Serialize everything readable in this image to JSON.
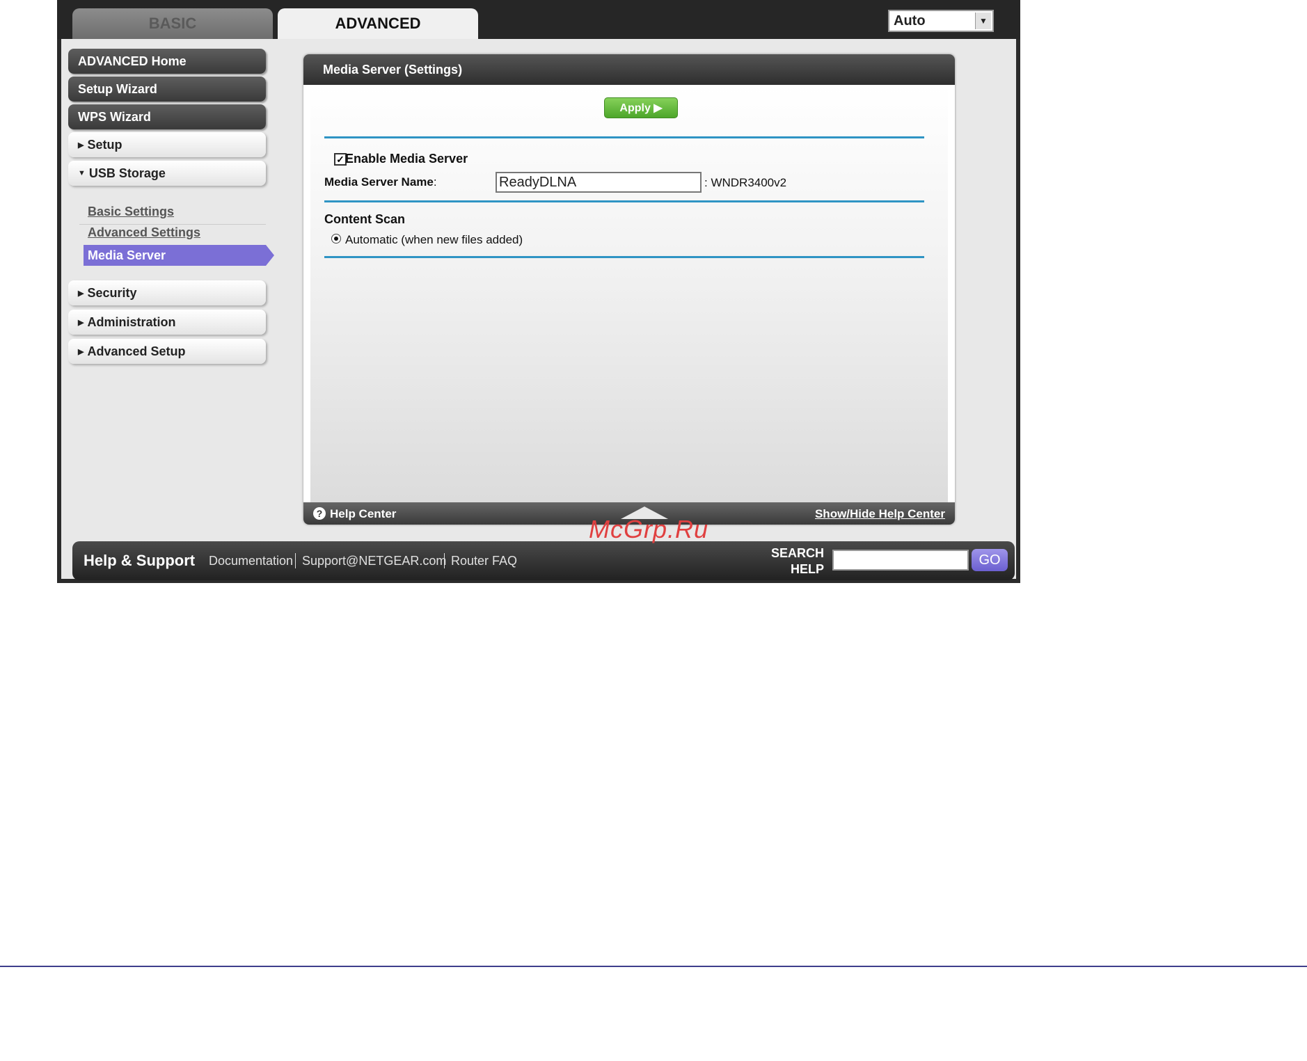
{
  "tabs": {
    "basic": "BASIC",
    "advanced": "ADVANCED"
  },
  "language_select": {
    "value": "Auto"
  },
  "sidebar": {
    "advanced_home": "ADVANCED Home",
    "setup_wizard": "Setup Wizard",
    "wps_wizard": "WPS Wizard",
    "setup": "Setup",
    "usb_storage": "USB Storage",
    "usb_items": [
      "Basic Settings",
      "Advanced Settings",
      "Media Server"
    ],
    "security": "Security",
    "administration": "Administration",
    "advanced_setup": "Advanced Setup"
  },
  "panel": {
    "title": "Media Server (Settings)",
    "apply_label": "Apply ▶",
    "enable_label": "Enable Media Server",
    "enable_checked": true,
    "server_name_label": "Media Server Name",
    "server_name_value": "ReadyDLNA",
    "server_name_suffix": ": WNDR3400v2",
    "content_scan_title": "Content Scan",
    "content_scan_option": "Automatic (when new files added)",
    "help_center_label": "Help Center",
    "show_hide_label": "Show/Hide Help Center"
  },
  "footer": {
    "title": "Help & Support",
    "links": [
      "Documentation",
      "Support@NETGEAR.com",
      "Router FAQ"
    ],
    "search_label_line1": "SEARCH",
    "search_label_line2": "HELP",
    "go_label": "GO"
  },
  "watermark": "McGrp.Ru",
  "colors": {
    "accent_blue": "#2f94c4",
    "apply_green": "#5db534",
    "nav_active_purple": "#7b6fd6",
    "watermark_red": "#e04040"
  }
}
